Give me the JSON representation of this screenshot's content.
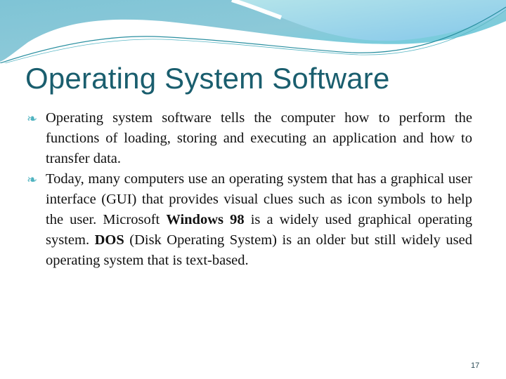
{
  "slide": {
    "title": "Operating System Software",
    "bullets": [
      {
        "parts": [
          {
            "text": "Operating system software tells the computer how to perform the functions of loading, storing and executing an application and how to transfer data.",
            "bold": false
          }
        ]
      },
      {
        "parts": [
          {
            "text": "Today, many computers use an operating system that has a graphical user interface (GUI) that provides visual clues such as icon symbols to help the user. Microsoft ",
            "bold": false
          },
          {
            "text": "Windows 98",
            "bold": true
          },
          {
            "text": " is a widely used graphical operating system. ",
            "bold": false
          },
          {
            "text": "DOS",
            "bold": true
          },
          {
            "text": " (Disk Operating System) is an older but still widely used operating system that is text-based.",
            "bold": false
          }
        ]
      }
    ],
    "bullet_icon": "scroll-bullet-icon",
    "page_number": "17"
  },
  "colors": {
    "title": "#1a5e6e",
    "accent": "#4fb3c0",
    "wave_light": "#a8dde6",
    "wave_mid": "#6cc7d8"
  }
}
